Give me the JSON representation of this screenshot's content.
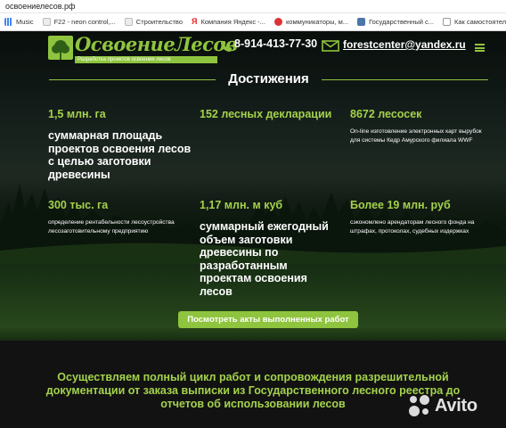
{
  "browser": {
    "url": "освоениелесов.рф",
    "bookmarks": [
      {
        "label": "Music",
        "icon": "grid"
      },
      {
        "label": "F22 - neon control,...",
        "icon": "file"
      },
      {
        "label": "Строительство",
        "icon": "file"
      },
      {
        "label": "Компания Яндекс -...",
        "icon": "ya"
      },
      {
        "label": "коммуникаторы, м...",
        "icon": "dot"
      },
      {
        "label": "Государственный с...",
        "icon": "vk"
      },
      {
        "label": "Как самостоятельн...",
        "icon": "doc"
      }
    ]
  },
  "header": {
    "logo_title": "ОсвоениеЛесов",
    "logo_subtitle": "Разработка проектов освоения лесов",
    "phone": "8-914-413-77-30",
    "email": "forestcenter@yandex.ru"
  },
  "section": {
    "title": "Достижения"
  },
  "stats": [
    {
      "number": "1,5 млн. га",
      "text": "суммарная площадь проектов освоения лесов с целью заготовки древесины",
      "style": "big"
    },
    {
      "number": "152 лесных декларации",
      "text": "",
      "style": "big"
    },
    {
      "number": "8672 лесосек",
      "text": "On-line изготовление электронных карт вырубок для системы Кедр Амурского филиала WWF",
      "style": "small"
    },
    {
      "number": "300 тыс. га",
      "text": "определение рентабельности лесоустройства лесозаготовительному предприятию",
      "style": "small"
    },
    {
      "number": "1,17 млн. м куб",
      "text": "суммарный ежегодный объем заготовки древесины по разработанным проектам освоения лесов",
      "style": "big"
    },
    {
      "number": "Более 19 млн. руб",
      "text": "сэкономлено арендаторам лесного фонда на штрафах, протоколах, судебных издержках",
      "style": "small"
    }
  ],
  "acts_button": "Посмотреть акты выполненных работ",
  "bottom_text": "Осуществляем полный цикл работ и сопровождения разрешительной документации от заказа выписки из Государственного лесного реестра до отчетов об использовании лесов",
  "watermark": "Avito",
  "colors": {
    "accent": "#8fc43f",
    "accent_text": "#a4d24b",
    "dark_bg": "#121212"
  }
}
